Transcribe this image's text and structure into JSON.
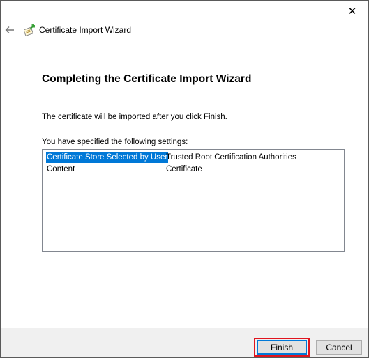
{
  "window": {
    "close_glyph": "✕"
  },
  "header": {
    "title": "Certificate Import Wizard",
    "back_icon": "back-arrow-icon",
    "wizard_icon": "certificate-icon"
  },
  "main": {
    "heading": "Completing the Certificate Import Wizard",
    "info": "The certificate will be imported after you click Finish.",
    "settings_label": "You have specified the following settings:",
    "settings": [
      {
        "key": "Certificate Store Selected by User",
        "value": "Trusted Root Certification Authorities",
        "selected": true
      },
      {
        "key": "Content",
        "value": "Certificate",
        "selected": false
      }
    ]
  },
  "footer": {
    "finish_label": "Finish",
    "cancel_label": "Cancel"
  },
  "colors": {
    "selection": "#0078d7",
    "highlight_outline": "#e0141e",
    "footer_bg": "#f0f0f0"
  }
}
